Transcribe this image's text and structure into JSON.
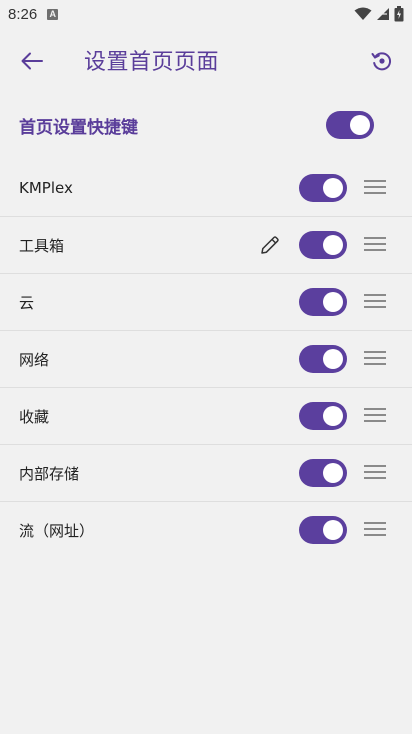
{
  "status_bar": {
    "time": "8:26",
    "notification_icon": "A"
  },
  "header": {
    "title": "设置首页页面"
  },
  "master": {
    "label": "首页设置快捷键",
    "enabled": true
  },
  "items": [
    {
      "label": "KMPlex",
      "enabled": true,
      "editable": false
    },
    {
      "label": "工具箱",
      "enabled": true,
      "editable": true
    },
    {
      "label": "云",
      "enabled": true,
      "editable": false
    },
    {
      "label": "网络",
      "enabled": true,
      "editable": false
    },
    {
      "label": "收藏",
      "enabled": true,
      "editable": false
    },
    {
      "label": "内部存储",
      "enabled": true,
      "editable": false
    },
    {
      "label": "流（网址）",
      "enabled": true,
      "editable": false
    }
  ],
  "colors": {
    "accent": "#5b3f9e",
    "title": "#5a3d9a",
    "background": "#f1f1f1"
  }
}
